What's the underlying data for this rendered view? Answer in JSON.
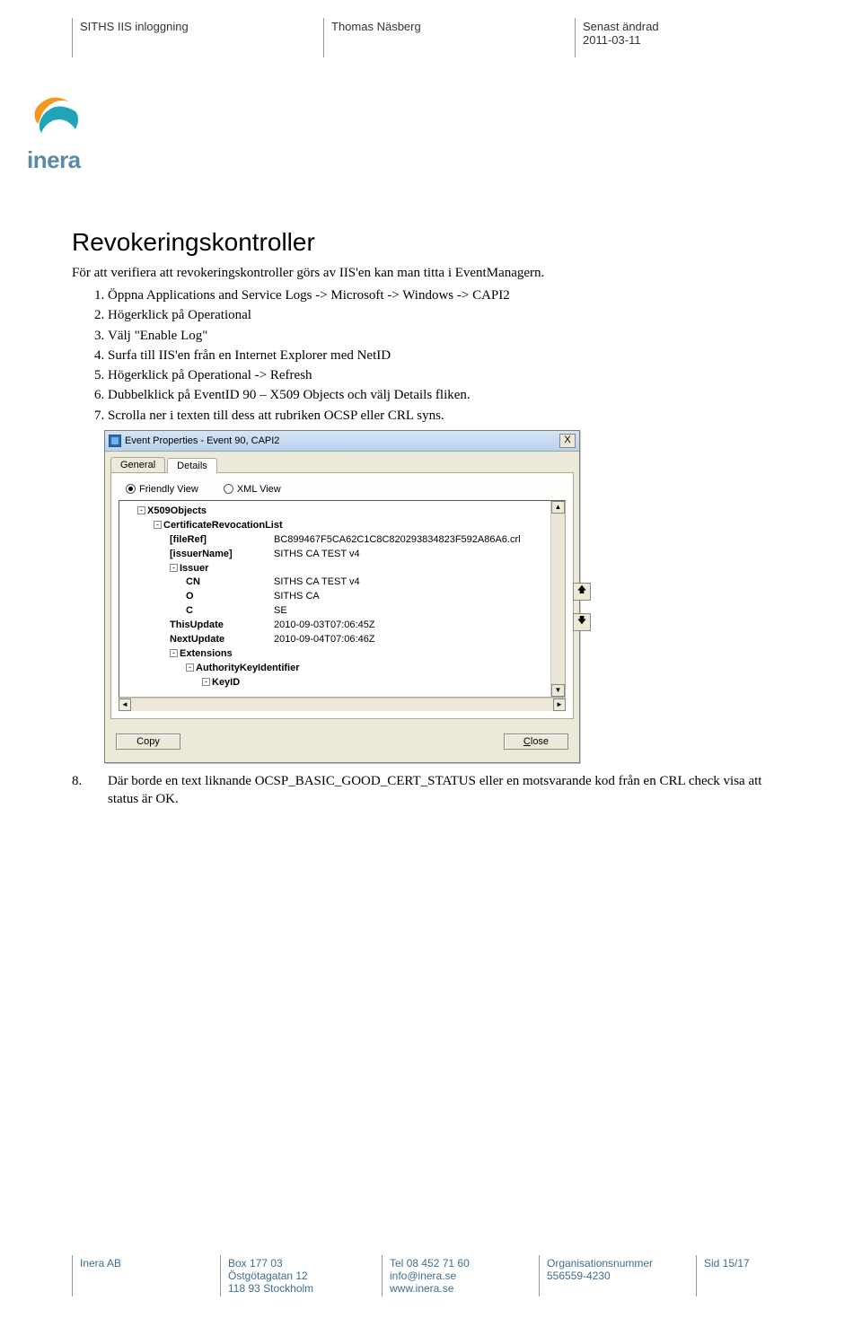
{
  "header": {
    "col1": "SITHS IIS inloggning",
    "col2": "Thomas Näsberg",
    "col3_line1": "Senast ändrad",
    "col3_line2": "2011-03-11"
  },
  "logo": {
    "text": "inera"
  },
  "title": "Revokeringskontroller",
  "intro": "För att verifiera att revokeringskontroller görs av IIS'en kan man titta i EventManagern.",
  "steps": [
    "Öppna Applications and Service Logs -> Microsoft -> Windows -> CAPI2",
    "Högerklick på Operational",
    "Välj \"Enable Log\"",
    "Surfa till IIS'en från en Internet Explorer med NetID",
    "Högerklick på Operational -> Refresh",
    "Dubbelklick på  EventID 90 – X509 Objects och välj Details fliken.",
    "Scrolla ner i texten till dess att rubriken OCSP eller CRL syns."
  ],
  "dialog": {
    "title": "Event Properties - Event 90, CAPI2",
    "close_glyph": "X",
    "tabs": {
      "general": "General",
      "details": "Details"
    },
    "radio": {
      "friendly": "Friendly View",
      "xml": "XML View"
    },
    "tree": [
      {
        "indent": 1,
        "collapse": true,
        "key": "X509Objects",
        "bold": true,
        "val": ""
      },
      {
        "indent": 2,
        "collapse": true,
        "key": "CertificateRevocationList",
        "bold": true,
        "val": ""
      },
      {
        "indent": 3,
        "key": "[fileRef]",
        "bold": true,
        "val": "BC899467F5CA62C1C8C820293834823F592A86A6.crl"
      },
      {
        "indent": 3,
        "key": "[issuerName]",
        "bold": true,
        "val": "SITHS CA TEST v4"
      },
      {
        "indent": 3,
        "collapse": true,
        "key": "Issuer",
        "bold": true,
        "val": ""
      },
      {
        "indent": 4,
        "key": "CN",
        "bold": true,
        "val": "SITHS CA TEST v4"
      },
      {
        "indent": 4,
        "key": "O",
        "bold": true,
        "val": "SITHS CA"
      },
      {
        "indent": 4,
        "key": "C",
        "bold": true,
        "val": "SE"
      },
      {
        "indent": 3,
        "key": "ThisUpdate",
        "bold": true,
        "val": "2010-09-03T07:06:45Z"
      },
      {
        "indent": 3,
        "key": "NextUpdate",
        "bold": true,
        "val": "2010-09-04T07:06:46Z"
      },
      {
        "indent": 3,
        "collapse": true,
        "key": "Extensions",
        "bold": true,
        "val": ""
      },
      {
        "indent": 4,
        "collapse": true,
        "key": "AuthorityKeyIdentifier",
        "bold": true,
        "val": ""
      },
      {
        "indent": 5,
        "collapse": true,
        "key": "KeyID",
        "bold": true,
        "val": ""
      }
    ],
    "footer": {
      "copy": "Copy",
      "close": "Close"
    }
  },
  "step8": "Där borde en text liknande OCSP_BASIC_GOOD_CERT_STATUS eller en motsvarande kod från en CRL check visa att status är OK.",
  "footer": {
    "c1": "Inera AB",
    "c2_l1": "Box 177 03",
    "c2_l2": "Östgötagatan 12",
    "c2_l3": "118 93 Stockholm",
    "c3_l1": "Tel 08 452 71 60",
    "c3_l2": "info@inera.se",
    "c3_l3": "www.inera.se",
    "c4_l1": "Organisationsnummer",
    "c4_l2": "556559-4230",
    "c5": "Sid 15/17"
  }
}
